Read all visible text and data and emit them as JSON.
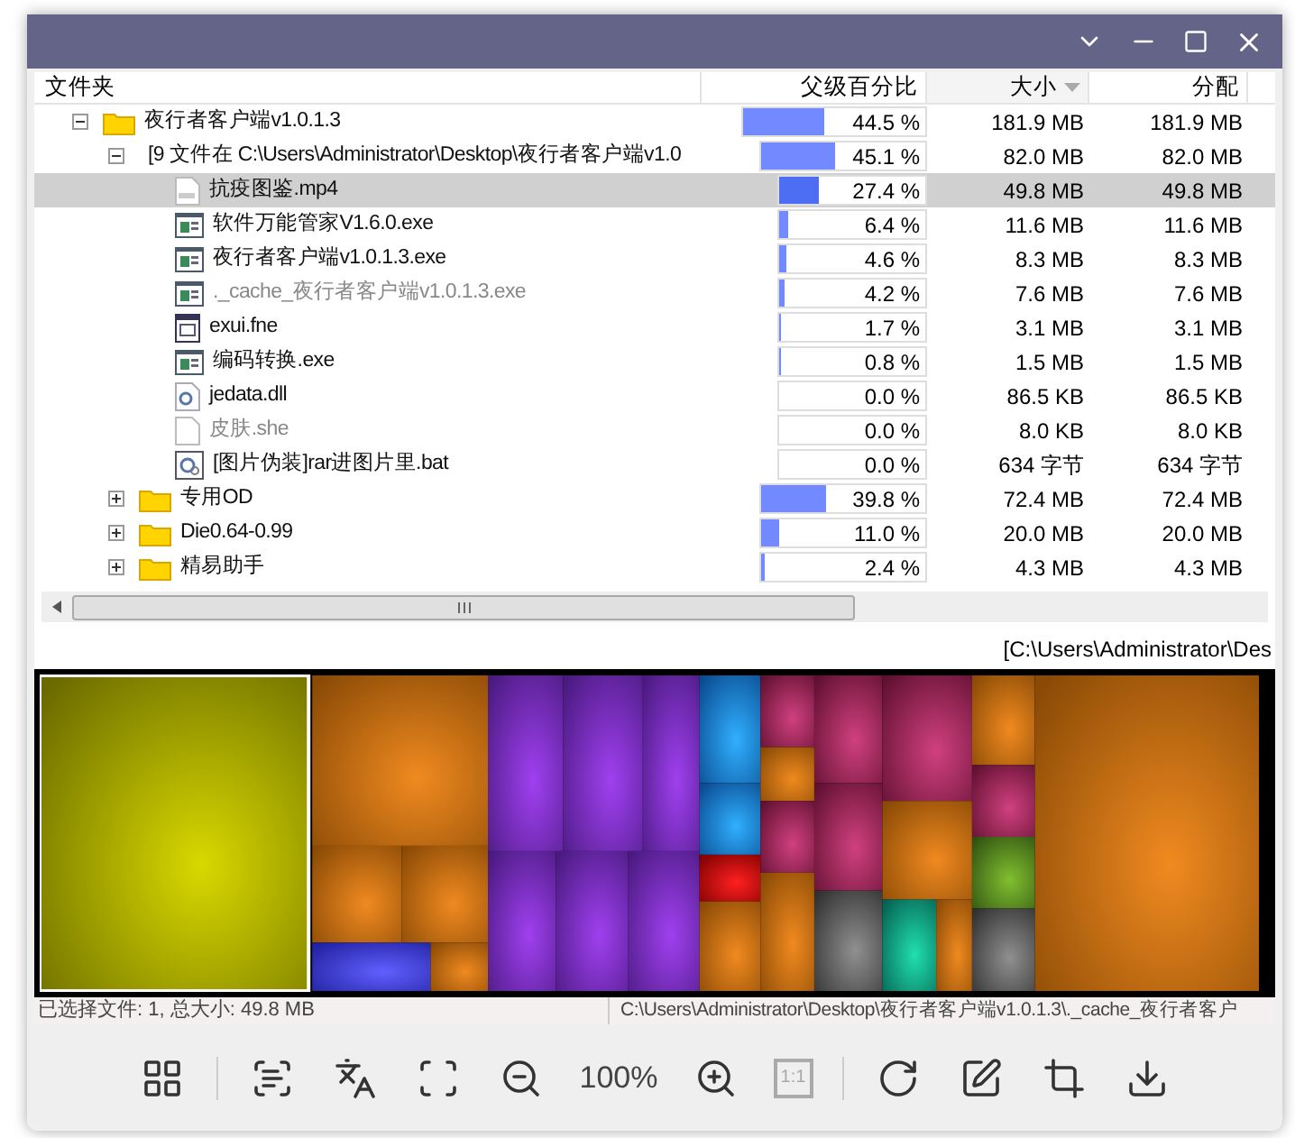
{
  "columns": [
    {
      "label": "文件夹",
      "sorted": false
    },
    {
      "label": "父级百分比",
      "sorted": false
    },
    {
      "label": "大小",
      "sorted": true
    },
    {
      "label": "分配",
      "sorted": false
    }
  ],
  "rows": [
    {
      "kind": "folder",
      "name": "夜行者客户端v1.0.1.3",
      "expanded": true,
      "selected": false,
      "dim": false,
      "percent": "44.5 %",
      "level": 0.445,
      "size": "181.9 MB",
      "alloc": "181.9 MB",
      "children": [
        {
          "kind": "files",
          "name": "[9 文件在 C:\\Users\\Administrator\\Desktop\\夜行者客户端v1.0",
          "expanded": true,
          "selected": false,
          "dim": false,
          "percent": "45.1 %",
          "level": 0.451,
          "size": "82.0 MB",
          "alloc": "82.0 MB",
          "children": [
            {
              "kind": "video",
              "name": "抗疫图鉴.mp4",
              "selected": true,
              "dim": false,
              "percent": "27.4 %",
              "level": 0.274,
              "size": "49.8 MB",
              "alloc": "49.8 MB"
            },
            {
              "kind": "app",
              "name": "软件万能管家V1.6.0.exe",
              "selected": false,
              "dim": false,
              "percent": "6.4 %",
              "level": 0.064,
              "size": "11.6 MB",
              "alloc": "11.6 MB"
            },
            {
              "kind": "app",
              "name": "夜行者客户端v1.0.1.3.exe",
              "selected": false,
              "dim": false,
              "percent": "4.6 %",
              "level": 0.046,
              "size": "8.3 MB",
              "alloc": "8.3 MB"
            },
            {
              "kind": "app",
              "name": "._cache_夜行者客户端v1.0.1.3.exe",
              "selected": false,
              "dim": true,
              "percent": "4.2 %",
              "level": 0.042,
              "size": "7.6 MB",
              "alloc": "7.6 MB"
            },
            {
              "kind": "module",
              "name": "exui.fne",
              "selected": false,
              "dim": false,
              "percent": "1.7 %",
              "level": 0.017,
              "size": "3.1 MB",
              "alloc": "3.1 MB"
            },
            {
              "kind": "app",
              "name": "编码转换.exe",
              "selected": false,
              "dim": false,
              "percent": "0.8 %",
              "level": 0.008,
              "size": "1.5 MB",
              "alloc": "1.5 MB"
            },
            {
              "kind": "library",
              "name": "jedata.dll",
              "selected": false,
              "dim": false,
              "percent": "0.0 %",
              "level": 0,
              "size": "86.5 KB",
              "alloc": "86.5 KB"
            },
            {
              "kind": "blank",
              "name": "皮肤.she",
              "selected": false,
              "dim": true,
              "percent": "0.0 %",
              "level": 0,
              "size": "8.0 KB",
              "alloc": "8.0 KB"
            },
            {
              "kind": "script",
              "name": "[图片伪装]rar进图片里.bat",
              "selected": false,
              "dim": false,
              "percent": "0.0 %",
              "level": 0,
              "size": "634 字节",
              "alloc": "634 字节"
            }
          ]
        },
        {
          "kind": "folder",
          "name": "专用OD",
          "expanded": false,
          "selected": false,
          "dim": false,
          "percent": "39.8 %",
          "level": 0.398,
          "size": "72.4 MB",
          "alloc": "72.4 MB"
        },
        {
          "kind": "folder",
          "name": "Die0.64-0.99",
          "expanded": false,
          "selected": false,
          "dim": false,
          "percent": "11.0 %",
          "level": 0.11,
          "size": "20.0 MB",
          "alloc": "20.0 MB"
        },
        {
          "kind": "folder",
          "name": "精易助手",
          "expanded": false,
          "selected": false,
          "dim": false,
          "percent": "2.4 %",
          "level": 0.024,
          "size": "4.3 MB",
          "alloc": "4.3 MB"
        }
      ]
    }
  ],
  "path_label": "[C:\\Users\\Administrator\\Des",
  "status_bar": {
    "left": "已选择文件: 1, 总大小: 49.8 MB",
    "right": "C:\\Users\\Administrator\\Desktop\\夜行者客户端v1.0.1.3\\._cache_夜行者客户"
  },
  "toolbar": [
    {
      "kind": "icon",
      "divider_after": true
    },
    {
      "kind": "icon",
      "divider_after": false
    },
    {
      "kind": "icon",
      "divider_after": false
    },
    {
      "kind": "icon",
      "divider_after": false
    },
    {
      "kind": "icon",
      "divider_after": false
    },
    {
      "kind": "text",
      "label": "100%",
      "divider_after": false
    },
    {
      "kind": "icon",
      "divider_after": false
    },
    {
      "kind": "ratio",
      "label": "1:1",
      "disabled": true,
      "divider_after": true
    },
    {
      "kind": "icon",
      "divider_after": false
    },
    {
      "kind": "icon",
      "divider_after": false
    },
    {
      "kind": "icon",
      "divider_after": false
    },
    {
      "kind": "icon",
      "divider_after": false
    }
  ]
}
